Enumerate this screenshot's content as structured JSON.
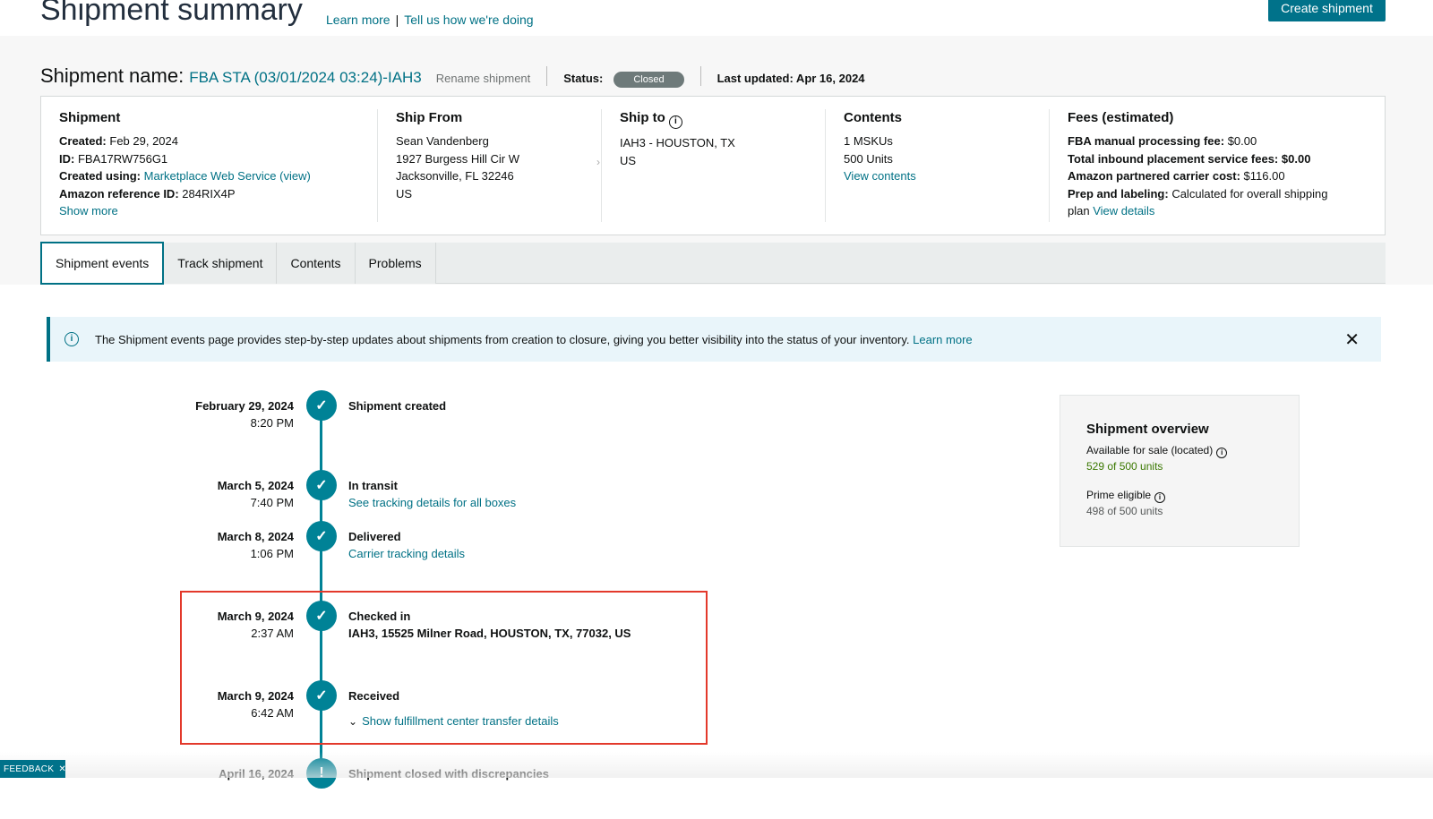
{
  "header": {
    "title": "Shipment summary",
    "learn_more": "Learn more",
    "separator": "|",
    "feedback_link": "Tell us how we're doing",
    "create_button": "Create shipment"
  },
  "shipment_row": {
    "name_label": "Shipment name:",
    "name_value": "FBA STA (03/01/2024 03:24)-IAH3",
    "rename": "Rename shipment",
    "status_label": "Status:",
    "status_value": "Closed",
    "last_updated": "Last updated: Apr 16, 2024"
  },
  "summary": {
    "shipment": {
      "title": "Shipment",
      "created_label": "Created:",
      "created_value": "Feb 29, 2024",
      "id_label": "ID:",
      "id_value": "FBA17RW756G1",
      "created_using_label": "Created using:",
      "created_using_value": "Marketplace Web Service (view)",
      "ref_label": "Amazon reference ID:",
      "ref_value": "284RIX4P",
      "show_more": "Show more"
    },
    "ship_from": {
      "title": "Ship From",
      "line1": "Sean Vandenberg",
      "line2": "1927 Burgess Hill Cir W",
      "line3": "Jacksonville, FL 32246",
      "line4": "US"
    },
    "ship_to": {
      "title": "Ship to",
      "line1": "IAH3 - HOUSTON, TX",
      "line2": "US"
    },
    "contents": {
      "title": "Contents",
      "mskus": "1 MSKUs",
      "units": "500 Units",
      "view": "View contents"
    },
    "fees": {
      "title": "Fees (estimated)",
      "manual_label": "FBA manual processing fee:",
      "manual_value": "$0.00",
      "placement_label": "Total inbound placement service fees:",
      "placement_value": "$0.00",
      "carrier_label": "Amazon partnered carrier cost:",
      "carrier_value": "$116.00",
      "prep_label": "Prep and labeling:",
      "prep_value": "Calculated for overall shipping",
      "prep_value2": "plan",
      "view_details": "View details"
    }
  },
  "tabs": [
    "Shipment events",
    "Track shipment",
    "Contents",
    "Problems"
  ],
  "alert": {
    "text": "The Shipment events page provides step-by-step updates about shipments from creation to closure, giving you better visibility into the status of your inventory.",
    "link": "Learn more",
    "close": "✕"
  },
  "events": [
    {
      "date": "February 29, 2024",
      "time": "8:20 PM",
      "title": "Shipment created",
      "detail": ""
    },
    {
      "date": "March 5, 2024",
      "time": "7:40 PM",
      "title": "In transit",
      "detail": "See tracking details for all boxes"
    },
    {
      "date": "March 8, 2024",
      "time": "1:06 PM",
      "title": "Delivered",
      "detail": "Carrier tracking details"
    },
    {
      "date": "March 9, 2024",
      "time": "2:37 AM",
      "title": "Checked in",
      "detail": "IAH3, 15525 Milner Road, HOUSTON, TX, 77032, US"
    },
    {
      "date": "March 9, 2024",
      "time": "6:42 AM",
      "title": "Received",
      "detail": "Show fulfillment center transfer details"
    },
    {
      "date": "April 16, 2024",
      "time": "",
      "title": "Shipment closed with discrepancies",
      "detail": ""
    }
  ],
  "overview": {
    "title": "Shipment overview",
    "available_label": "Available for sale (located)",
    "available_value": "529 of 500 units",
    "prime_label": "Prime eligible",
    "prime_value": "498 of 500 units"
  },
  "feedback_tab": "FEEDBACK",
  "feedback_close": "✕",
  "colors": {
    "teal": "#008296",
    "link": "#007185",
    "highlight_border": "#e3392b",
    "status_pill": "#6e7a7a",
    "available_green": "#3a7800"
  }
}
